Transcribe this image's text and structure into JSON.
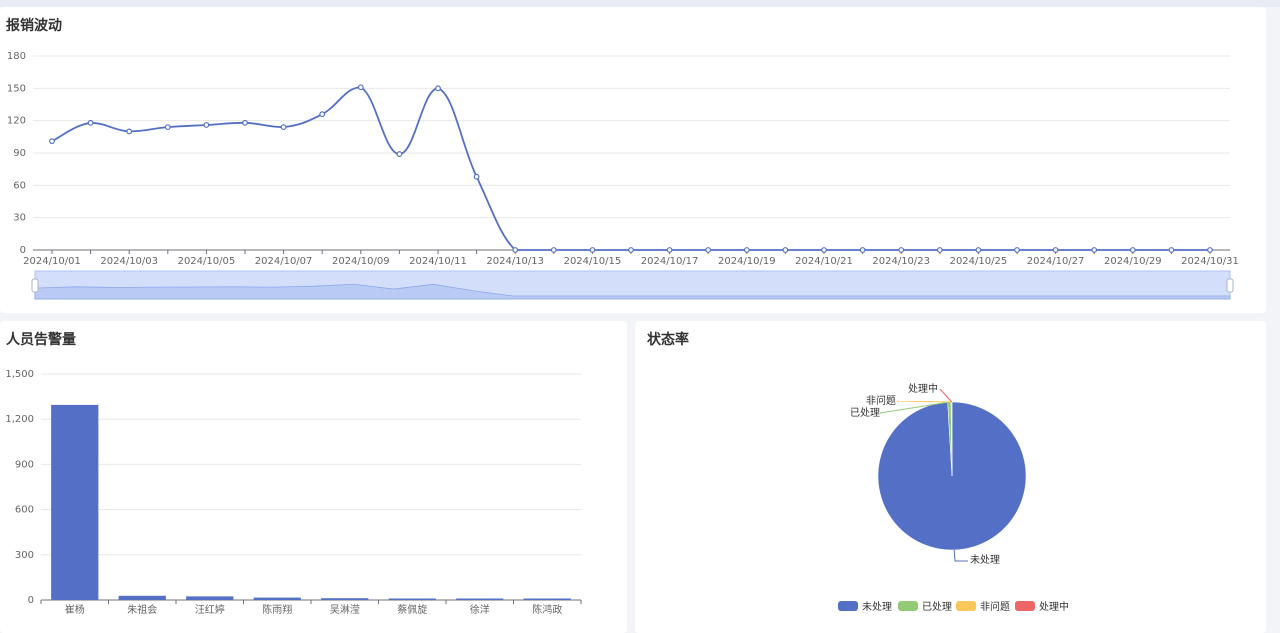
{
  "panels": {
    "fluctuation_title": "报销波动",
    "alerts_title": "人员告警量",
    "status_title": "状态率"
  },
  "colors": {
    "primary": "#5470c6",
    "green": "#91cc75",
    "yellow": "#fac858",
    "red": "#ee6666",
    "grid": "#e8e8e8"
  },
  "chart_data": [
    {
      "type": "line",
      "smooth": true,
      "x": [
        "2024/10/01",
        "2024/10/02",
        "2024/10/03",
        "2024/10/04",
        "2024/10/05",
        "2024/10/06",
        "2024/10/07",
        "2024/10/08",
        "2024/10/09",
        "2024/10/10",
        "2024/10/11",
        "2024/10/12",
        "2024/10/13",
        "2024/10/14",
        "2024/10/15",
        "2024/10/16",
        "2024/10/17",
        "2024/10/18",
        "2024/10/19",
        "2024/10/20",
        "2024/10/21",
        "2024/10/22",
        "2024/10/23",
        "2024/10/24",
        "2024/10/25",
        "2024/10/26",
        "2024/10/27",
        "2024/10/28",
        "2024/10/29",
        "2024/10/30",
        "2024/10/31"
      ],
      "x_tick_labels": [
        "2024/10/01",
        "2024/10/03",
        "2024/10/05",
        "2024/10/07",
        "2024/10/09",
        "2024/10/11",
        "2024/10/13",
        "2024/10/15",
        "2024/10/17",
        "2024/10/19",
        "2024/10/21",
        "2024/10/23",
        "2024/10/25",
        "2024/10/27",
        "2024/10/29",
        "2024/10/31"
      ],
      "values": [
        101,
        118,
        110,
        114,
        116,
        118,
        114,
        126,
        151,
        89,
        150,
        68,
        0,
        0,
        0,
        0,
        0,
        0,
        0,
        0,
        0,
        0,
        0,
        0,
        0,
        0,
        0,
        0,
        0,
        0,
        0
      ],
      "y_ticks": [
        "0",
        "30",
        "60",
        "90",
        "120",
        "150",
        "180"
      ],
      "ylim": [
        0,
        180
      ],
      "grid": true,
      "datazoom_slider": true
    },
    {
      "type": "bar",
      "categories": [
        "崔杨",
        "朱祖会",
        "汪红婷",
        "陈雨翔",
        "吴淋滢",
        "蔡佩旋",
        "徐洋",
        "陈鸿政"
      ],
      "values": [
        1295,
        28,
        24,
        16,
        12,
        9,
        7,
        5
      ],
      "y_ticks": [
        "0",
        "300",
        "600",
        "900",
        "1,200",
        "1,500"
      ],
      "ylim": [
        0,
        1500
      ],
      "grid": true
    },
    {
      "type": "pie",
      "labels": [
        "未处理",
        "已处理",
        "非问题",
        "处理中"
      ],
      "values": [
        1380,
        10,
        2,
        1
      ],
      "legend": "bottom"
    }
  ]
}
